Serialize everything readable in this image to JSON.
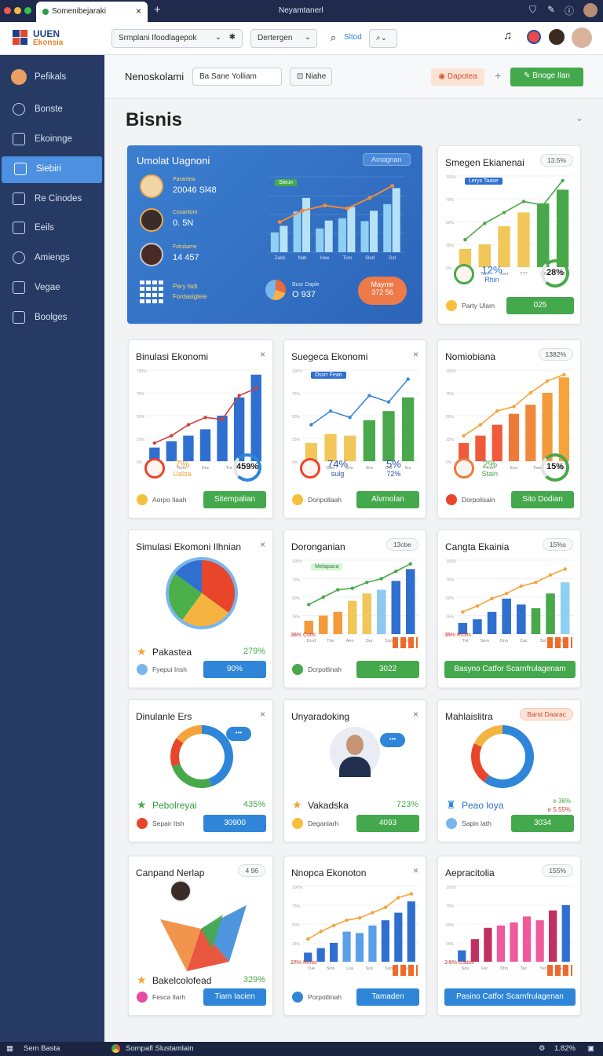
{
  "browser": {
    "tab_title": "Somenibejaraki",
    "window_title": "Neyamtanerl"
  },
  "topbar": {
    "brand_line1": "UUEN",
    "brand_line2": "Ekonsia",
    "search_value": "Srmplani Ifoodlagepok",
    "select_value": "Dertergen",
    "search_button": "Sltod"
  },
  "sidebar": {
    "items": [
      {
        "label": "Pefikals"
      },
      {
        "label": "Bonste"
      },
      {
        "label": "Ekoinnge"
      },
      {
        "label": "Siebiri"
      },
      {
        "label": "Re Cinodes"
      },
      {
        "label": "Eeils"
      },
      {
        "label": "Amiengs"
      },
      {
        "label": "Vegae"
      },
      {
        "label": "Boolges"
      }
    ]
  },
  "subbar": {
    "title": "Nenoskolami",
    "filter_value": "Ba Sane Yolliam",
    "filter_button": "Niahe",
    "warn_button": "Dapotea",
    "primary_button": "Bnoge Ilan"
  },
  "page": {
    "heading": "Bisnis"
  },
  "hero": {
    "title": "Umolat Uagnoni",
    "pill": "Amagnan",
    "people": [
      {
        "label": "Parantea",
        "value": "20046 Sl48"
      },
      {
        "label": "Cosanlom",
        "value": "0. 5N"
      },
      {
        "label": "Fotuliame",
        "value": "14 457"
      }
    ],
    "grid_label1": "Pery Isdi",
    "grid_label2": "Fordasigleie",
    "chart_badge": "Sieun",
    "pie_label": "Busr Daple",
    "pie_value": "O 937",
    "cta_line1": "Maynie",
    "cta_line2": "372 56",
    "chart_data": {
      "type": "bar",
      "categories": [
        "Zasb",
        "Nab",
        "Ioee",
        "Tion",
        "Slod",
        "Dst"
      ],
      "values": [
        35,
        72,
        42,
        60,
        55,
        85
      ],
      "line": [
        40,
        55,
        62,
        58,
        72,
        88
      ]
    }
  },
  "cards": [
    {
      "title": "Smegen Ekianenai",
      "pill": "13.5%",
      "badge": "Lerys Taase",
      "stats": [
        {
          "v": "12%",
          "l": "Rhin"
        },
        {
          "v": "28%",
          "l": ""
        }
      ],
      "foot": "Party Ulam",
      "btn": "025",
      "chart_data": {
        "type": "bar",
        "categories": [
          "Daas",
          "Tam",
          "Aart",
          "T?7",
          "1!8",
          "2!2"
        ],
        "values": [
          20,
          25,
          45,
          60,
          70,
          85
        ],
        "line": [
          30,
          48,
          60,
          72,
          68,
          95
        ]
      }
    },
    {
      "title": "Binulasi Ekonomi",
      "badge": "",
      "stats": [
        {
          "v": "7%",
          "l": "Ualsa"
        },
        {
          "v": "459%",
          "l": ""
        }
      ],
      "foot": "Aorpo Ilaah",
      "btn": "Sitempalian",
      "chart_data": {
        "type": "bar",
        "categories": [
          "Sen",
          "Smo",
          "Dnc",
          "Tnt",
          "Sin"
        ],
        "values": [
          15,
          22,
          28,
          35,
          50,
          70,
          95
        ],
        "line": [
          20,
          28,
          40,
          48,
          46,
          72,
          80
        ]
      }
    },
    {
      "title": "Suegeca Ekonomi",
      "badge": "Dssrr Fean",
      "stats": [
        {
          "v": "74%",
          "l": "sulg"
        },
        {
          "v": "5%",
          "l": "72%"
        }
      ],
      "foot": "Donpollaah",
      "btn": "Alvrnolan",
      "chart_data": {
        "type": "bar",
        "categories": [
          "Dcr",
          "Dsio",
          "Dor",
          "Sirs",
          "Dst",
          "Srz"
        ],
        "values": [
          20,
          30,
          28,
          45,
          55,
          70
        ],
        "line": [
          40,
          55,
          48,
          72,
          65,
          90
        ]
      }
    },
    {
      "title": "Nomiobiana",
      "pill": "1382%",
      "stats": [
        {
          "v": "2%",
          "l": "Stain"
        },
        {
          "v": "15%",
          "l": ""
        }
      ],
      "foot": "Dorpolisain",
      "btn": "Sito Dodian",
      "chart_data": {
        "type": "bar",
        "categories": [
          "Tan",
          "Dan",
          "Eoo",
          "Tam",
          "Stin"
        ],
        "values": [
          20,
          28,
          40,
          52,
          62,
          75,
          92
        ],
        "line": [
          28,
          40,
          55,
          60,
          75,
          88,
          95
        ]
      }
    },
    {
      "title": "Simulasi Ekomoni Ilhnian",
      "foot_label": "Pakastea",
      "foot_value": "279%",
      "foot": "Fyepui Insh",
      "btn": "90%",
      "chart_data": {
        "type": "pie",
        "values": [
          35,
          25,
          25,
          15
        ]
      }
    },
    {
      "title": "Doronganian",
      "pill": "13cbe",
      "badge": "Melapaca",
      "caption": "36% Cutis",
      "foot": "Dcrpotlinah",
      "btn": "3022",
      "chart_data": {
        "type": "bar",
        "categories": [
          "Dcuf",
          "Ttor",
          "Ano",
          "Dur",
          "Soo",
          "Sob"
        ],
        "values": [
          18,
          25,
          30,
          45,
          55,
          60,
          72,
          88
        ],
        "line": [
          40,
          50,
          60,
          62,
          70,
          75,
          85,
          95
        ]
      }
    },
    {
      "title": "Cangta Ekainia",
      "pill": "15%s",
      "caption": "35% Rtolts",
      "foot": "Basyno Catfor Scarnfrulagenam",
      "btn": "",
      "chart_data": {
        "type": "bar",
        "categories": [
          "Tnt",
          "Sem",
          "Dno",
          "Cac",
          "Sst",
          "Stt"
        ],
        "values": [
          15,
          20,
          30,
          48,
          40,
          35,
          55,
          70
        ],
        "line": [
          30,
          38,
          48,
          55,
          65,
          70,
          80,
          88
        ]
      }
    },
    {
      "title": "Dinulanle Ers",
      "badge": "",
      "foot_label": "Pebolreyai",
      "foot_value": "435%",
      "foot": "Sepair Itsh",
      "btn": "30900",
      "chart_data": {
        "type": "donut",
        "values": [
          45,
          25,
          15,
          15
        ]
      }
    },
    {
      "title": "Unyaradoking",
      "foot_label": "Vakadska",
      "foot_value": "723%",
      "foot": "Deganiarh",
      "btn": "4093"
    },
    {
      "title": "Mahlaislitra",
      "pill": "Barst Daarac",
      "legend": [
        "e 36%",
        "e 5.55%"
      ],
      "foot_label": "Peao loya",
      "foot": "Sapin lath",
      "btn": "3034",
      "chart_data": {
        "type": "donut",
        "values": [
          60,
          22,
          18
        ]
      }
    },
    {
      "title": "Canpand Nerlap",
      "pill": "4 96",
      "foot_label": "Bakelcolofead",
      "foot_value": "329%",
      "foot": "Fesca Ilarh",
      "btn": "Tiam Iacien"
    },
    {
      "title": "Nnopca Ekonoton",
      "caption": "27% Reltis",
      "foot": "Porpotlinah",
      "btn": "Tamaden",
      "chart_data": {
        "type": "bar",
        "categories": [
          "Tue",
          "Sins",
          "Lsa",
          "Sos",
          "Son",
          "Sdd"
        ],
        "values": [
          12,
          18,
          25,
          40,
          38,
          48,
          55,
          65,
          80
        ],
        "line": [
          30,
          40,
          48,
          55,
          58,
          65,
          72,
          85,
          90
        ]
      }
    },
    {
      "title": "Aepracitolia",
      "pill": "155%",
      "caption": "2 5% Cadse",
      "foot": "Pasino Catfor Scarnfrulagenan",
      "btn": "",
      "chart_data": {
        "type": "bar",
        "categories": [
          "Sos",
          "Fxr",
          "Dtin",
          "Tac",
          "Tiet",
          "Sen"
        ],
        "values": [
          15,
          30,
          45,
          48,
          52,
          60,
          55,
          68,
          75
        ]
      }
    }
  ],
  "taskbar": {
    "left": "Sem Basta",
    "app": "Sompafl Slustamlain",
    "time": "1.82%"
  }
}
